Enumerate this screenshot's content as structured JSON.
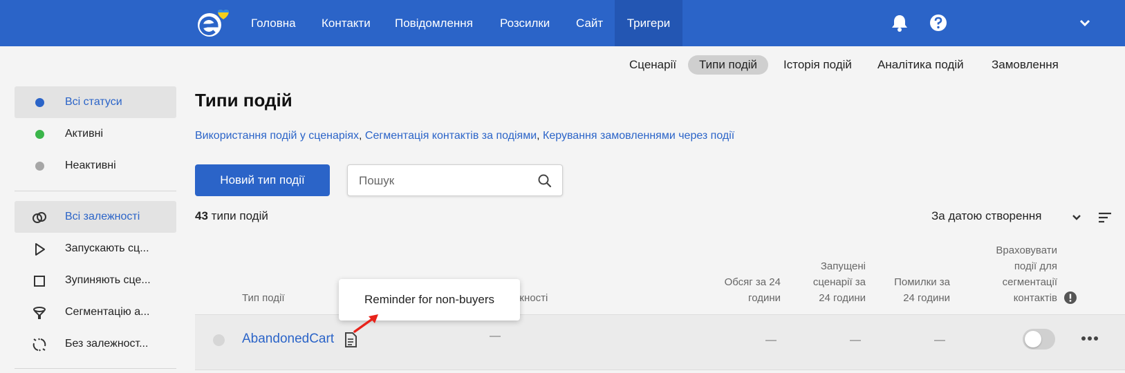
{
  "nav": {
    "items": [
      "Головна",
      "Контакти",
      "Повідомлення",
      "Розсилки",
      "Сайт",
      "Тригери"
    ],
    "active_index": 5
  },
  "subnav": {
    "items": [
      "Сценарії",
      "Типи подій",
      "Історія подій",
      "Аналітика подій",
      "Замовлення"
    ],
    "active_index": 1
  },
  "sidebar": {
    "status": [
      {
        "label": "Всі статуси",
        "color": "#2b64c8",
        "active": true
      },
      {
        "label": "Активні",
        "color": "#3ab54a",
        "active": false
      },
      {
        "label": "Неактивні",
        "color": "#a6a6a6",
        "active": false
      }
    ],
    "dependencies": [
      {
        "label": "Всі залежності",
        "icon": "link-icon",
        "active": true
      },
      {
        "label": "Запускають сц...",
        "icon": "play-icon",
        "active": false
      },
      {
        "label": "Зупиняють сце...",
        "icon": "stop-icon",
        "active": false
      },
      {
        "label": "Сегментацію а...",
        "icon": "funnel-icon",
        "active": false
      },
      {
        "label": "Без залежност...",
        "icon": "unlinked-icon",
        "active": false
      }
    ]
  },
  "main": {
    "title": "Типи подій",
    "links": [
      "Використання подій у сценаріях",
      "Сегментація контактів за подіями",
      "Керування замовленнями через події"
    ],
    "link_separator": ", ",
    "new_button": "Новий тип події",
    "search_placeholder": "Пошук",
    "count_number": "43",
    "count_label": "типи подій",
    "sort_label": "За датою створення"
  },
  "table": {
    "headers": {
      "type": "Тип події",
      "deps": "жності",
      "volume": [
        "Обсяг за 24",
        "години"
      ],
      "scenarios": [
        "Запущені",
        "сценарії за",
        "24 години"
      ],
      "errors": [
        "Помилки за",
        "24 години"
      ],
      "segment": [
        "Враховувати",
        "події для",
        "сегментації",
        "контактів"
      ]
    },
    "rows": [
      {
        "name": "AbandonedCart",
        "deps": "—",
        "volume": "—",
        "scenarios": "—",
        "errors": "—",
        "segmentation_enabled": false
      }
    ]
  },
  "tooltip": {
    "text": "Reminder for non-buyers"
  },
  "colors": {
    "brand": "#2b64c8",
    "arrow": "#e8231b"
  }
}
